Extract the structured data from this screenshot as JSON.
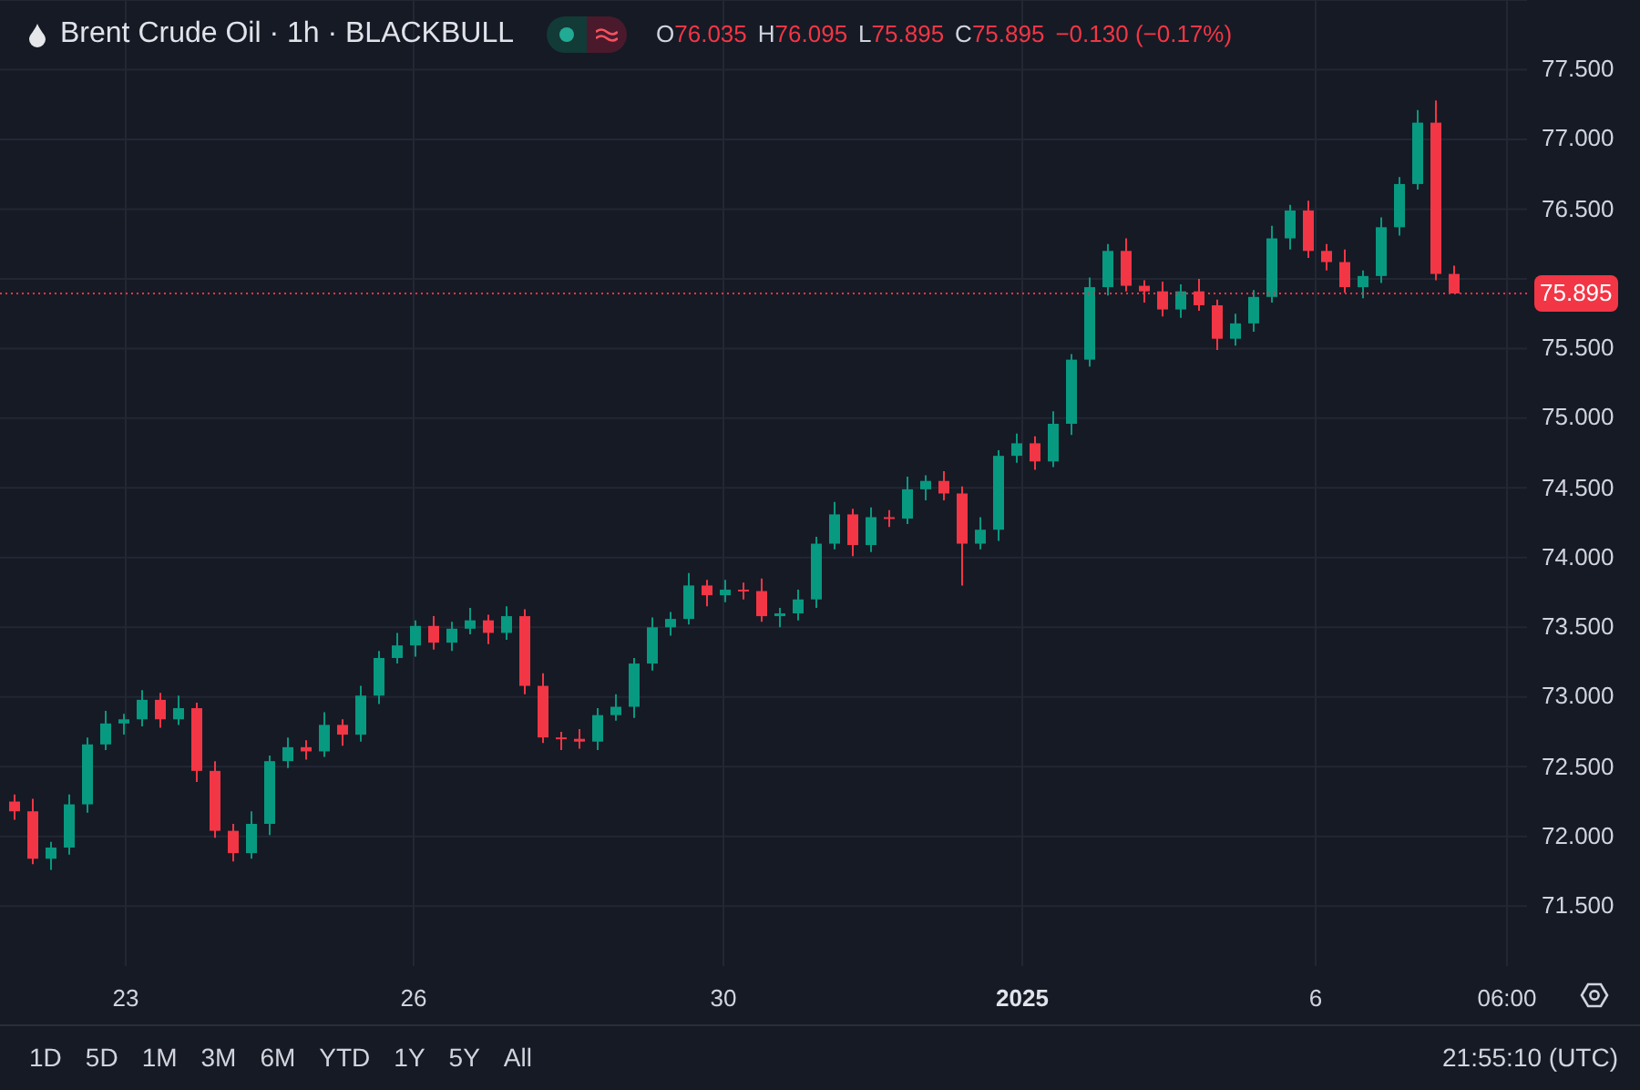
{
  "legend": {
    "symbol": "Brent Crude Oil · 1h · BLACKBULL",
    "values": [
      {
        "label": "O",
        "value": "76.035"
      },
      {
        "label": "H",
        "value": "76.095"
      },
      {
        "label": "L",
        "value": "75.895"
      },
      {
        "label": "C",
        "value": "75.895"
      }
    ],
    "change": "−0.130 (−0.17%)"
  },
  "chart": {
    "chart_data": {
      "type": "candlestick",
      "categories": [
        null,
        null,
        null,
        null,
        null,
        null,
        null,
        null,
        null,
        null,
        null,
        null,
        null,
        null,
        null,
        null,
        null,
        null,
        null,
        null,
        null,
        null,
        null,
        null,
        null,
        null,
        null,
        null,
        null,
        null,
        null,
        null,
        null,
        null,
        null,
        null,
        null,
        null,
        null,
        null,
        null,
        null,
        null,
        null,
        null,
        null,
        null,
        null,
        null,
        null,
        null,
        null,
        null,
        null,
        null,
        null,
        null,
        null,
        null,
        null,
        null,
        null,
        null,
        null,
        null,
        null,
        null,
        null,
        null,
        null,
        null,
        null,
        null,
        null,
        null,
        null,
        null,
        null,
        null,
        null
      ],
      "ohlc": [
        [
          72.25,
          72.3,
          72.12,
          72.18
        ],
        [
          72.18,
          72.27,
          71.8,
          71.84
        ],
        [
          71.84,
          71.96,
          71.76,
          71.92
        ],
        [
          71.92,
          72.3,
          71.87,
          72.23
        ],
        [
          72.23,
          72.71,
          72.17,
          72.66
        ],
        [
          72.66,
          72.9,
          72.62,
          72.81
        ],
        [
          72.81,
          72.88,
          72.73,
          72.84
        ],
        [
          72.84,
          73.05,
          72.79,
          72.98
        ],
        [
          72.98,
          73.03,
          72.78,
          72.84
        ],
        [
          72.84,
          73.01,
          72.8,
          72.92
        ],
        [
          72.92,
          72.96,
          72.39,
          72.47
        ],
        [
          72.47,
          72.54,
          71.99,
          72.04
        ],
        [
          72.04,
          72.09,
          71.82,
          71.88
        ],
        [
          71.88,
          72.18,
          71.84,
          72.09
        ],
        [
          72.09,
          72.58,
          72.01,
          72.54
        ],
        [
          72.54,
          72.71,
          72.49,
          72.64
        ],
        [
          72.64,
          72.69,
          72.55,
          72.61
        ],
        [
          72.61,
          72.89,
          72.57,
          72.8
        ],
        [
          72.8,
          72.84,
          72.65,
          72.73
        ],
        [
          72.73,
          73.08,
          72.68,
          73.01
        ],
        [
          73.01,
          73.33,
          72.95,
          73.28
        ],
        [
          73.28,
          73.46,
          73.24,
          73.37
        ],
        [
          73.37,
          73.55,
          73.29,
          73.51
        ],
        [
          73.51,
          73.58,
          73.34,
          73.39
        ],
        [
          73.39,
          73.54,
          73.33,
          73.49
        ],
        [
          73.49,
          73.64,
          73.45,
          73.55
        ],
        [
          73.55,
          73.59,
          73.38,
          73.46
        ],
        [
          73.46,
          73.65,
          73.41,
          73.58
        ],
        [
          73.58,
          73.63,
          73.02,
          73.08
        ],
        [
          73.08,
          73.17,
          72.67,
          72.71
        ],
        [
          72.71,
          72.75,
          72.62,
          72.7
        ],
        [
          72.7,
          72.77,
          72.63,
          72.68
        ],
        [
          72.68,
          72.92,
          72.62,
          72.87
        ],
        [
          72.87,
          73.02,
          72.83,
          72.93
        ],
        [
          72.93,
          73.28,
          72.85,
          73.24
        ],
        [
          73.24,
          73.57,
          73.19,
          73.5
        ],
        [
          73.5,
          73.61,
          73.44,
          73.56
        ],
        [
          73.56,
          73.89,
          73.52,
          73.8
        ],
        [
          73.8,
          73.84,
          73.65,
          73.73
        ],
        [
          73.73,
          73.84,
          73.68,
          73.77
        ],
        [
          73.77,
          73.82,
          73.7,
          73.76
        ],
        [
          73.76,
          73.85,
          73.54,
          73.58
        ],
        [
          73.58,
          73.64,
          73.5,
          73.6
        ],
        [
          73.6,
          73.77,
          73.55,
          73.7
        ],
        [
          73.7,
          74.15,
          73.64,
          74.1
        ],
        [
          74.1,
          74.4,
          74.06,
          74.31
        ],
        [
          74.31,
          74.35,
          74.01,
          74.09
        ],
        [
          74.09,
          74.36,
          74.04,
          74.29
        ],
        [
          74.29,
          74.34,
          74.22,
          74.28
        ],
        [
          74.28,
          74.58,
          74.24,
          74.49
        ],
        [
          74.49,
          74.59,
          74.41,
          74.55
        ],
        [
          74.55,
          74.62,
          74.41,
          74.46
        ],
        [
          74.46,
          74.51,
          73.8,
          74.1
        ],
        [
          74.1,
          74.29,
          74.06,
          74.2
        ],
        [
          74.2,
          74.77,
          74.12,
          74.73
        ],
        [
          74.73,
          74.89,
          74.68,
          74.82
        ],
        [
          74.82,
          74.87,
          74.63,
          74.69
        ],
        [
          74.69,
          75.05,
          74.65,
          74.96
        ],
        [
          74.96,
          75.46,
          74.88,
          75.42
        ],
        [
          75.42,
          76.01,
          75.37,
          75.94
        ],
        [
          75.94,
          76.25,
          75.88,
          76.2
        ],
        [
          76.2,
          76.29,
          75.91,
          75.95
        ],
        [
          75.95,
          75.99,
          75.83,
          75.91
        ],
        [
          75.91,
          75.98,
          75.73,
          75.78
        ],
        [
          75.78,
          75.96,
          75.72,
          75.91
        ],
        [
          75.91,
          76.0,
          75.77,
          75.81
        ],
        [
          75.81,
          75.85,
          75.49,
          75.57
        ],
        [
          75.57,
          75.75,
          75.52,
          75.68
        ],
        [
          75.68,
          75.92,
          75.62,
          75.87
        ],
        [
          75.87,
          76.38,
          75.83,
          76.29
        ],
        [
          76.29,
          76.53,
          76.21,
          76.49
        ],
        [
          76.49,
          76.56,
          76.15,
          76.2
        ],
        [
          76.2,
          76.25,
          76.06,
          76.12
        ],
        [
          76.12,
          76.21,
          75.9,
          75.94
        ],
        [
          75.94,
          76.06,
          75.86,
          76.02
        ],
        [
          76.02,
          76.44,
          75.97,
          76.37
        ],
        [
          76.37,
          76.73,
          76.31,
          76.68
        ],
        [
          76.68,
          77.21,
          76.64,
          77.12
        ],
        [
          77.12,
          77.28,
          75.99,
          76.035
        ],
        [
          76.035,
          76.095,
          75.895,
          75.895
        ]
      ],
      "ylim": [
        71.07,
        78.0
      ],
      "grid": true,
      "ref_lines": [
        {
          "axis": "y",
          "value": 75.895,
          "color": "#f23645"
        }
      ],
      "yticks": [
        {
          "value": 77.5,
          "label": "77.500"
        },
        {
          "value": 77.0,
          "label": "77.000"
        },
        {
          "value": 76.5,
          "label": "76.500"
        },
        {
          "value": 75.5,
          "label": "75.500"
        },
        {
          "value": 75.0,
          "label": "75.000"
        },
        {
          "value": 74.5,
          "label": "74.500"
        },
        {
          "value": 74.0,
          "label": "74.000"
        },
        {
          "value": 73.5,
          "label": "73.500"
        },
        {
          "value": 73.0,
          "label": "73.000"
        },
        {
          "value": 72.5,
          "label": "72.500"
        },
        {
          "value": 72.0,
          "label": "72.000"
        },
        {
          "value": 71.5,
          "label": "71.500"
        }
      ]
    },
    "time_labels": [
      {
        "label": "23",
        "bold": false
      },
      {
        "label": "26",
        "bold": false
      },
      {
        "label": "30",
        "bold": false
      },
      {
        "label": "2025",
        "bold": true
      },
      {
        "label": "6",
        "bold": false
      },
      {
        "label": "06:00",
        "bold": false
      }
    ],
    "last_price": "75.895"
  },
  "ranges": [
    "1D",
    "5D",
    "1M",
    "3M",
    "6M",
    "YTD",
    "1Y",
    "5Y",
    "All"
  ],
  "clock": "21:55:10 (UTC)"
}
